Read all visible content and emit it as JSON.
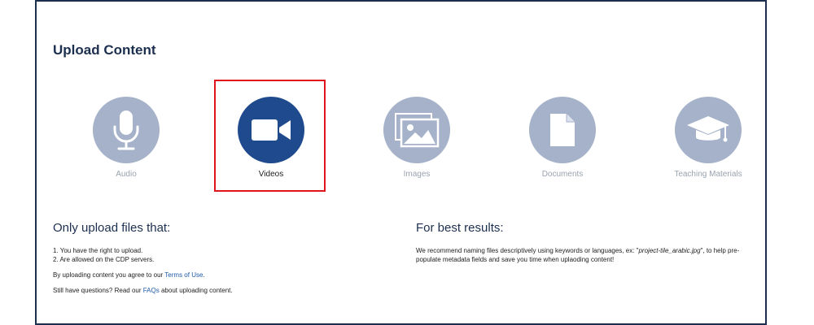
{
  "page": {
    "title": "Upload Content"
  },
  "types": [
    {
      "label": "Audio",
      "icon": "microphone-icon",
      "selected": false
    },
    {
      "label": "Videos",
      "icon": "video-camera-icon",
      "selected": true
    },
    {
      "label": "Images",
      "icon": "images-icon",
      "selected": false
    },
    {
      "label": "Documents",
      "icon": "document-icon",
      "selected": false
    },
    {
      "label": "Teaching Materials",
      "icon": "graduation-cap-icon",
      "selected": false
    }
  ],
  "rules": {
    "heading": "Only upload files that:",
    "item1": "1. You have the right to upload.",
    "item2": "2. Are allowed on the CDP servers.",
    "terms_prefix": "By uploading content you agree to our ",
    "terms_link": "Terms of Use",
    "terms_suffix": ".",
    "faq_prefix": "Still have questions? Read our ",
    "faq_link": "FAQs",
    "faq_suffix": " about uploading content."
  },
  "tips": {
    "heading": "For best results:",
    "text_prefix": "We recommend naming files descriptively using keywords or languages, ex: \"",
    "example": "project-tile_arabic.jpg",
    "text_suffix": "\", to help pre-populate metadata fields and save you time when uplaoding content!"
  },
  "colors": {
    "navy": "#1c2f4f",
    "selected_blue": "#1f4a8d",
    "inactive_circle": "#a5b2ca",
    "selection_border": "#e0151c",
    "link": "#1f5aa8"
  }
}
